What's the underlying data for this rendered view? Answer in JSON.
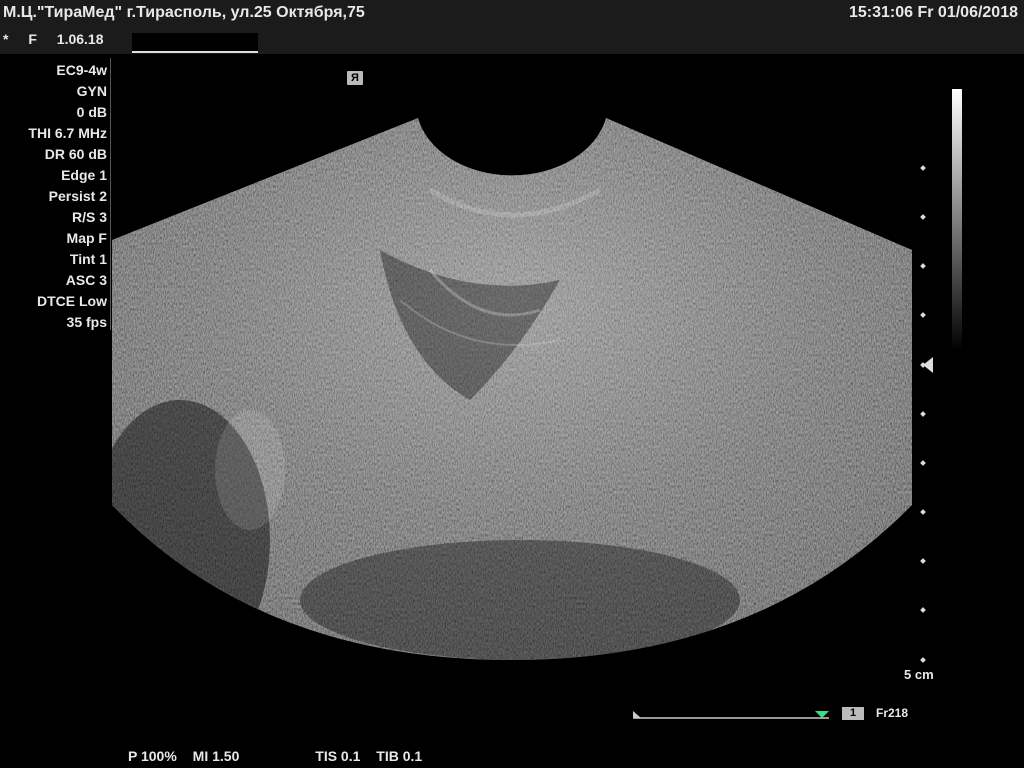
{
  "header": {
    "clinic": "М.Ц.\"ТираМед\" г.Тирасполь, ул.25 Октября,75",
    "datetime": "15:31:06  Fr  01/06/2018",
    "marker": "*",
    "sex": "F",
    "date": "1.06.18"
  },
  "params": [
    "EC9-4w",
    "GYN",
    "0 dB",
    "THI 6.7 MHz",
    "DR 60 dB",
    "Edge 1",
    "Persist 2",
    "R/S 3",
    "Map F",
    "Tint 1",
    "ASC 3",
    "DTCE Low",
    "35 fps"
  ],
  "orientation_marker": "Я",
  "depth": {
    "label": "5 cm"
  },
  "cine": {
    "number": "1",
    "frame": "Fr218"
  },
  "bottom": {
    "power": "P 100%",
    "mi": "MI 1.50",
    "tis": "TIS 0.1",
    "tib": "TIB 0.1"
  },
  "colors": {
    "background": "#000000",
    "header_bg": "#1b1b1b",
    "text": "#e8e8e8",
    "cine_accent": "#3ddc84"
  }
}
